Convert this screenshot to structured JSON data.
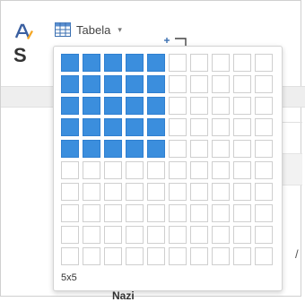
{
  "toolbar": {
    "table_label": "Tabela",
    "caret": "▾",
    "text_style_icon": "text-color-icon",
    "big_letter": "S",
    "insert_icon": "insert-column-icon"
  },
  "table_picker": {
    "rows": 10,
    "cols": 10,
    "selected_rows": 5,
    "selected_cols": 5,
    "size_label": "5x5"
  },
  "background": {
    "glyph": "/",
    "bottom_text": "Nazi..."
  },
  "colors": {
    "selected_cell": "#3b8edd",
    "cell_border": "#cfcfcf",
    "accent_orange": "#f5a623"
  }
}
